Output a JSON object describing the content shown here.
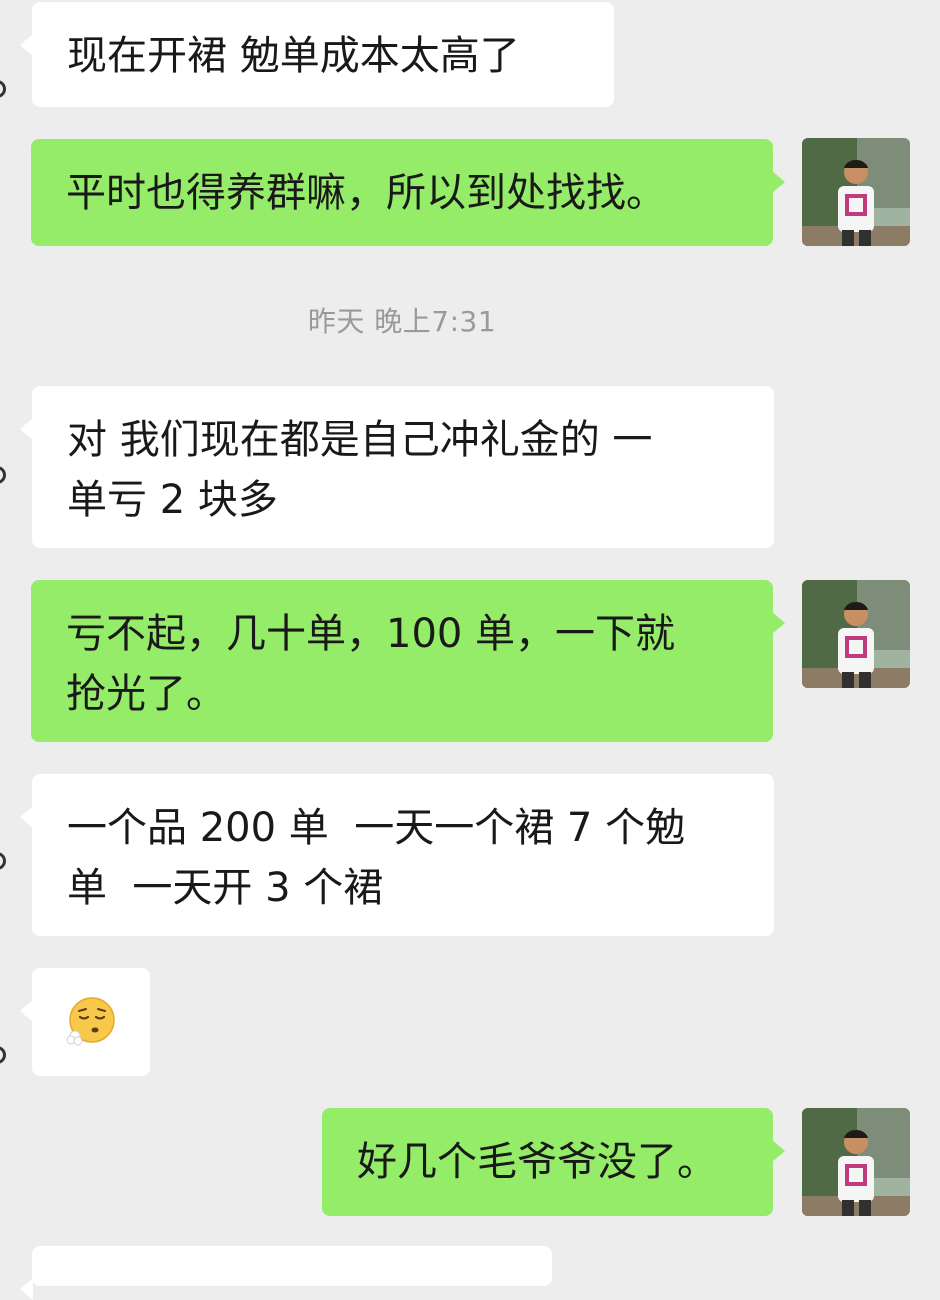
{
  "timestamp": "昨天 晚上7:31",
  "messages": [
    {
      "side": "in",
      "text": "现在开裙 勉单成本太高了"
    },
    {
      "side": "out",
      "text": "平时也得养群嘛，所以到处找找。"
    },
    {
      "side": "in",
      "text_line1": "对 我们现在都是自己冲礼金的 一",
      "text_line2": "单亏 2 块多"
    },
    {
      "side": "out",
      "text_line1": "亏不起，几十单，100 单，一下就",
      "text_line2": "抢光了。"
    },
    {
      "side": "in",
      "text_line1": "一个品 200 单  一天一个裙 7 个勉",
      "text_line2": "单  一天开 3 个裙"
    },
    {
      "side": "in",
      "emoji": "sighing-face"
    },
    {
      "side": "out",
      "text": "好几个毛爷爷没了。"
    }
  ],
  "colors": {
    "background": "#ededed",
    "incoming_bubble": "#ffffff",
    "outgoing_bubble": "#95ec69",
    "timestamp_text": "#9a9a9a"
  }
}
